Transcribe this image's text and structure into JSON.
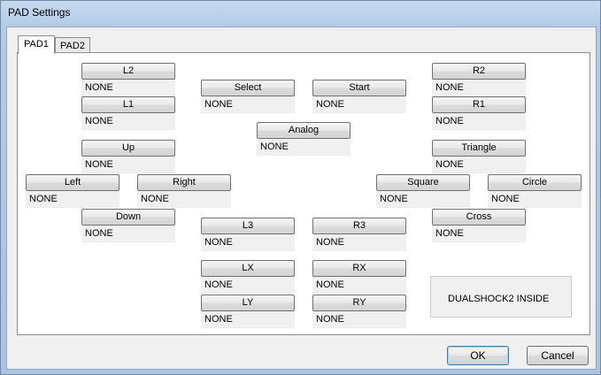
{
  "window": {
    "title": "PAD Settings"
  },
  "tabs": [
    {
      "label": "PAD1"
    },
    {
      "label": "PAD2"
    }
  ],
  "bindings": {
    "l2": {
      "label": "L2",
      "value": "NONE"
    },
    "l1": {
      "label": "L1",
      "value": "NONE"
    },
    "up": {
      "label": "Up",
      "value": "NONE"
    },
    "left": {
      "label": "Left",
      "value": "NONE"
    },
    "right": {
      "label": "Right",
      "value": "NONE"
    },
    "down": {
      "label": "Down",
      "value": "NONE"
    },
    "select": {
      "label": "Select",
      "value": "NONE"
    },
    "start": {
      "label": "Start",
      "value": "NONE"
    },
    "analog": {
      "label": "Analog",
      "value": "NONE"
    },
    "l3": {
      "label": "L3",
      "value": "NONE"
    },
    "r3": {
      "label": "R3",
      "value": "NONE"
    },
    "lx": {
      "label": "LX",
      "value": "NONE"
    },
    "rx": {
      "label": "RX",
      "value": "NONE"
    },
    "ly": {
      "label": "LY",
      "value": "NONE"
    },
    "ry": {
      "label": "RY",
      "value": "NONE"
    },
    "r2": {
      "label": "R2",
      "value": "NONE"
    },
    "r1": {
      "label": "R1",
      "value": "NONE"
    },
    "triangle": {
      "label": "Triangle",
      "value": "NONE"
    },
    "square": {
      "label": "Square",
      "value": "NONE"
    },
    "circle": {
      "label": "Circle",
      "value": "NONE"
    },
    "cross": {
      "label": "Cross",
      "value": "NONE"
    }
  },
  "info_box": {
    "text": "DUALSHOCK2 INSIDE"
  },
  "dialog": {
    "ok_label": "OK",
    "cancel_label": "Cancel"
  }
}
